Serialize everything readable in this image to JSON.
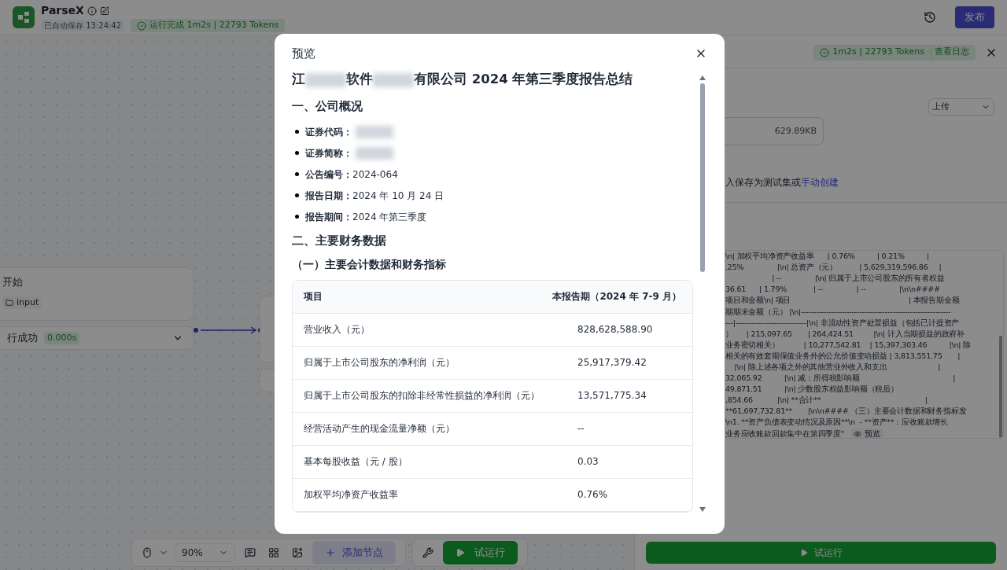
{
  "header": {
    "app_name": "ParseX",
    "autosave": "已自动保存 13:24:42",
    "run_status": "运行完成 1m2s | 22793 Tokens",
    "publish": "发布"
  },
  "canvas": {
    "start_node": {
      "title": "开始",
      "tag": "input",
      "status": "行成功",
      "time": "0.000s"
    }
  },
  "toolbar": {
    "zoom": "90%",
    "add_node": "添加节点",
    "run": "试运行"
  },
  "panel": {
    "status": "1m2s | 22793 Tokens",
    "log_link": "查看日志",
    "source_select": "上传",
    "file_size": "629.89KB",
    "hint": "入保存为测试集或",
    "hint_link": "手动创建",
    "output_lines": [
      "\\n| 加权平均净资产收益率      | 0.76%          | 0.21%          |",
      ".25%               |\\n| 总资产（元）          | 5,629,319,596.86     |",
      "                     | --               |\\n| 归属于上市公司股东的所有者权益",
      "36.61      | 1.79%            | --               | --               |\\n\\n####",
      "项目和金额\\n| 项目                                                     | 本报告期金额",
      "期期末金额（元） |\\n|-----------------------------------------------------------",
      "---|----------------------------|\\n| 非流动性资产处置损益（包括已计提资产",
      "）      | 215,097.65       | 264,424.51         |\\n| 计入当期损益的政府补",
      "业务密切相关）           | 10,277,542.81    | 15,397,303.46          |\\n| 除",
      "相关的有效套期保值业务外的公允价值变动损益 | 3,813,551.75       |",
      "    |\\n| 除上述各项之外的其他营业外收入和支出                       |",
      "32,065.92          |\\n| 减：所得税影响额                                          |",
      "49,871.51          |\\n| 少数股东权益影响额（税后）",
      ",854.66           |\\n| **合计**                                               |",
      "**61,697,732.81**       |\\n\\n#### （三）主要会计数据和财务指标发",
      "\\n1. **资产负债表变动情况及原因**\\n  - **资产**：应收账款增长",
      "业务应收账款回款集中在第四季度\""
    ],
    "preview": "预览",
    "run_button": "试运行"
  },
  "modal": {
    "title": "预览",
    "doc_title": [
      {
        "kind": "text",
        "text": "江"
      },
      {
        "kind": "redacted"
      },
      {
        "kind": "text",
        "text": "软件"
      },
      {
        "kind": "redacted"
      },
      {
        "kind": "text",
        "text": "有限公司 2024 年第三季度报告总结"
      }
    ],
    "section_1": "一、公司概况",
    "facts": [
      {
        "label": "证券代码：",
        "redacted": true
      },
      {
        "label": "证券简称：",
        "redacted": true
      },
      {
        "label": "公告编号：",
        "value": "2024-064",
        "redacted": false
      },
      {
        "label": "报告日期：",
        "value": "2024 年 10 月 24 日",
        "redacted": false
      },
      {
        "label": "报告期间：",
        "value": "2024 年第三季度",
        "redacted": false
      }
    ],
    "section_2": "二、主要财务数据",
    "subsection": "（一）主要会计数据和财务指标",
    "table": {
      "columns": [
        "项目",
        "本报告期（2024 年 7-9 月）"
      ],
      "rows": [
        [
          "营业收入（元）",
          "828,628,588.90"
        ],
        [
          "归属于上市公司股东的净利润（元）",
          "25,917,379.42"
        ],
        [
          "归属于上市公司股东的扣除非经常性损益的净利润（元）",
          "13,571,775.34"
        ],
        [
          "经营活动产生的现金流量净额（元）",
          "--"
        ],
        [
          "基本每股收益（元 / 股）",
          "0.03"
        ],
        [
          "加权平均净资产收益率",
          "0.76%"
        ]
      ]
    }
  }
}
